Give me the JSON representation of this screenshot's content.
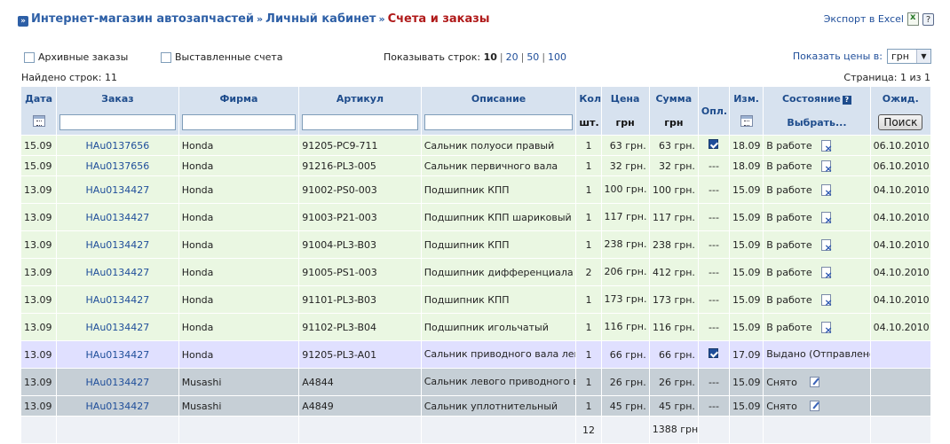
{
  "breadcrumb": {
    "items": [
      "Интернет-магазин автозапчастей",
      "Личный кабинет"
    ],
    "current": "Счета и заказы",
    "separator": "»"
  },
  "export": {
    "label": "Экспорт в Excel",
    "help": "?"
  },
  "filters": {
    "archive_label": "Архивные заказы",
    "invoices_label": "Выставленные счета",
    "rows_label": "Показывать строк:",
    "rows_options": [
      "10",
      "20",
      "50",
      "100"
    ],
    "price_label": "Показать цены в:",
    "currency": "грн"
  },
  "found": "Найдено строк: 11",
  "page_info": "Страница: 1 из 1",
  "columns": {
    "date": "Дата",
    "order": "Заказ",
    "firm": "Фирма",
    "article": "Артикул",
    "desc": "Описание",
    "qty": "Кол",
    "qty_unit": "шт.",
    "price": "Цена",
    "price_unit": "грн",
    "sum": "Сумма",
    "sum_unit": "грн",
    "paid": "Опл.",
    "changed": "Изм.",
    "status": "Состояние",
    "status_select": "Выбрать...",
    "expected": "Ожид.",
    "search_btn": "Поиск",
    "help": "?"
  },
  "rows": [
    {
      "date": "15.09",
      "order": "HAu0137656",
      "firm": "Honda",
      "article": "91205-PC9-711",
      "desc": "Сальник полуоси правый",
      "qty": "1",
      "price": "63 грн.",
      "sum": "63 грн.",
      "paid": true,
      "paid_text": "",
      "changed": "18.09",
      "status": "В работе",
      "expected": "06.10.2010"
    },
    {
      "date": "15.09",
      "order": "HAu0137656",
      "firm": "Honda",
      "article": "91216-PL3-005",
      "desc": "Сальник первичного вала",
      "qty": "1",
      "price": "32 грн.",
      "sum": "32 грн.",
      "paid": false,
      "paid_text": "---",
      "changed": "18.09",
      "status": "В работе",
      "expected": "06.10.2010"
    },
    {
      "date": "13.09",
      "order": "HAu0134427",
      "firm": "Honda",
      "article": "91002-PS0-003",
      "desc": "Подшипник КПП",
      "qty": "1",
      "price": "100 грн.",
      "sum": "100 грн.",
      "paid": false,
      "paid_text": "---",
      "changed": "15.09",
      "status": "В работе",
      "expected": "04.10.2010"
    },
    {
      "date": "13.09",
      "order": "HAu0134427",
      "firm": "Honda",
      "article": "91003-P21-003",
      "desc": "Подшипник КПП шариковый",
      "qty": "1",
      "price": "117 грн.",
      "sum": "117 грн.",
      "paid": false,
      "paid_text": "---",
      "changed": "15.09",
      "status": "В работе",
      "expected": "04.10.2010"
    },
    {
      "date": "13.09",
      "order": "HAu0134427",
      "firm": "Honda",
      "article": "91004-PL3-B03",
      "desc": "Подшипник КПП",
      "qty": "1",
      "price": "238 грн.",
      "sum": "238 грн.",
      "paid": false,
      "paid_text": "---",
      "changed": "15.09",
      "status": "В работе",
      "expected": "04.10.2010"
    },
    {
      "date": "13.09",
      "order": "HAu0134427",
      "firm": "Honda",
      "article": "91005-PS1-003",
      "desc": "Подшипник дифференциала",
      "qty": "2",
      "price": "206 грн.",
      "sum": "412 грн.",
      "paid": false,
      "paid_text": "---",
      "changed": "15.09",
      "status": "В работе",
      "expected": "04.10.2010"
    },
    {
      "date": "13.09",
      "order": "HAu0134427",
      "firm": "Honda",
      "article": "91101-PL3-B03",
      "desc": "Подшипник КПП",
      "qty": "1",
      "price": "173 грн.",
      "sum": "173 грн.",
      "paid": false,
      "paid_text": "---",
      "changed": "15.09",
      "status": "В работе",
      "expected": "04.10.2010"
    },
    {
      "date": "13.09",
      "order": "HAu0134427",
      "firm": "Honda",
      "article": "91102-PL3-B04",
      "desc": "Подшипник игольчатый",
      "qty": "1",
      "price": "116 грн.",
      "sum": "116 грн.",
      "paid": false,
      "paid_text": "---",
      "changed": "15.09",
      "status": "В работе",
      "expected": "04.10.2010"
    },
    {
      "date": "13.09",
      "order": "HAu0134427",
      "firm": "Honda",
      "article": "91205-PL3-A01",
      "desc": "Сальник приводного вала левого",
      "qty": "1",
      "price": "66 грн.",
      "sum": "66 грн.",
      "paid": true,
      "paid_text": "",
      "changed": "17.09",
      "status": "Выдано (Отправлено)",
      "expected": ""
    },
    {
      "date": "13.09",
      "order": "HAu0134427",
      "firm": "Musashi",
      "article": "A4844",
      "desc": "Сальник левого приводного вала",
      "qty": "1",
      "price": "26 грн.",
      "sum": "26 грн.",
      "paid": false,
      "paid_text": "---",
      "changed": "15.09",
      "status": "Снято",
      "expected": ""
    },
    {
      "date": "13.09",
      "order": "HAu0134427",
      "firm": "Musashi",
      "article": "A4849",
      "desc": "Сальник уплотнительный",
      "qty": "1",
      "price": "45 грн.",
      "sum": "45 грн.",
      "paid": false,
      "paid_text": "---",
      "changed": "15.09",
      "status": "Снято",
      "expected": ""
    }
  ],
  "totals": {
    "qty": "12",
    "sum": "1388 грн."
  },
  "colors": {
    "green_row": "#eaf7e2",
    "lilac_row": "#e0e0ff",
    "gray_row": "#c6cfd6",
    "header": "#d7e2ef",
    "link": "#1f4e9a",
    "current_crumb": "#b01a1a"
  }
}
